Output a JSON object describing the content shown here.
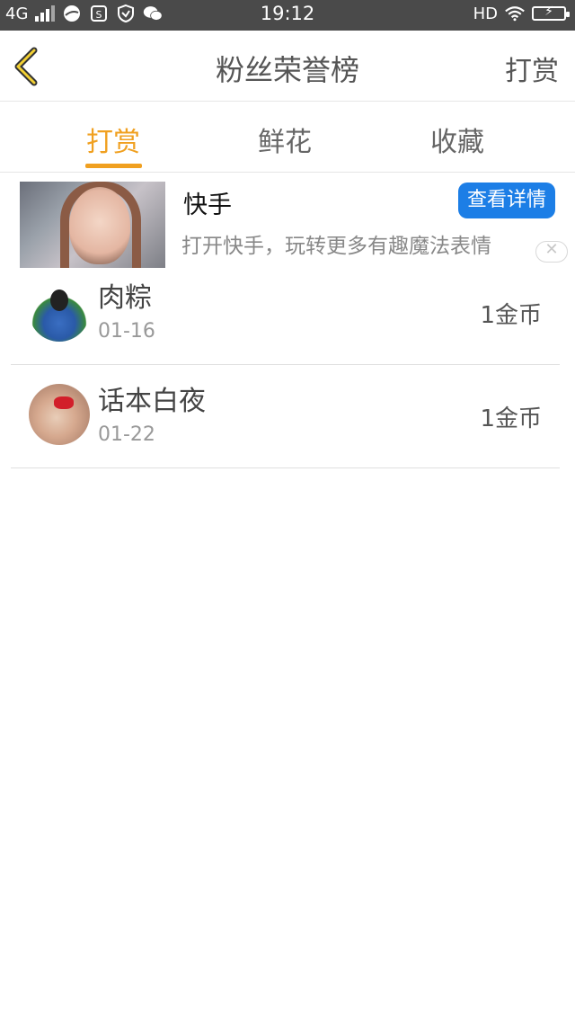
{
  "status_bar": {
    "network": "4G",
    "time": "19:12",
    "hd": "HD"
  },
  "header": {
    "title": "粉丝荣誉榜",
    "right_action": "打赏"
  },
  "tabs": [
    {
      "label": "打赏",
      "active": true
    },
    {
      "label": "鲜花",
      "active": false
    },
    {
      "label": "收藏",
      "active": false
    }
  ],
  "ad": {
    "title": "快手",
    "description": "打开快手，玩转更多有趣魔法表情",
    "button": "查看详情",
    "close": "✕"
  },
  "list": [
    {
      "name": "肉粽",
      "date": "01-16",
      "amount": "1金币"
    },
    {
      "name": "话本白夜",
      "date": "01-22",
      "amount": "1金币"
    }
  ],
  "colors": {
    "accent": "#f0a020",
    "button_blue": "#1c7ee6",
    "status_bar": "#4a4a4a"
  }
}
